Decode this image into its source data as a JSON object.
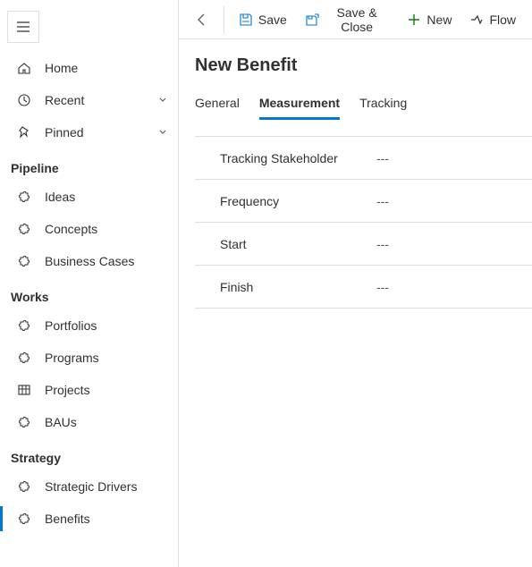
{
  "sidebar": {
    "top": [
      {
        "icon": "home",
        "label": "Home",
        "chevron": false
      },
      {
        "icon": "clock",
        "label": "Recent",
        "chevron": true
      },
      {
        "icon": "pin",
        "label": "Pinned",
        "chevron": true
      }
    ],
    "sections": [
      {
        "title": "Pipeline",
        "items": [
          {
            "icon": "puzzle",
            "label": "Ideas"
          },
          {
            "icon": "puzzle",
            "label": "Concepts"
          },
          {
            "icon": "puzzle",
            "label": "Business Cases"
          }
        ]
      },
      {
        "title": "Works",
        "items": [
          {
            "icon": "puzzle",
            "label": "Portfolios"
          },
          {
            "icon": "puzzle",
            "label": "Programs"
          },
          {
            "icon": "grid",
            "label": "Projects"
          },
          {
            "icon": "puzzle",
            "label": "BAUs"
          }
        ]
      },
      {
        "title": "Strategy",
        "items": [
          {
            "icon": "puzzle",
            "label": "Strategic Drivers"
          },
          {
            "icon": "puzzle",
            "label": "Benefits",
            "active": true
          }
        ]
      }
    ]
  },
  "cmdbar": {
    "back": "Back",
    "save": "Save",
    "saveClose": "Save & Close",
    "new": "New",
    "flow": "Flow"
  },
  "page": {
    "title": "New Benefit",
    "tabs": [
      {
        "label": "General",
        "active": false
      },
      {
        "label": "Measurement",
        "active": true
      },
      {
        "label": "Tracking",
        "active": false
      }
    ],
    "fields": [
      {
        "label": "Tracking Stakeholder",
        "value": "---"
      },
      {
        "label": "Frequency",
        "value": "---"
      },
      {
        "label": "Start",
        "value": "---"
      },
      {
        "label": "Finish",
        "value": "---"
      }
    ]
  }
}
